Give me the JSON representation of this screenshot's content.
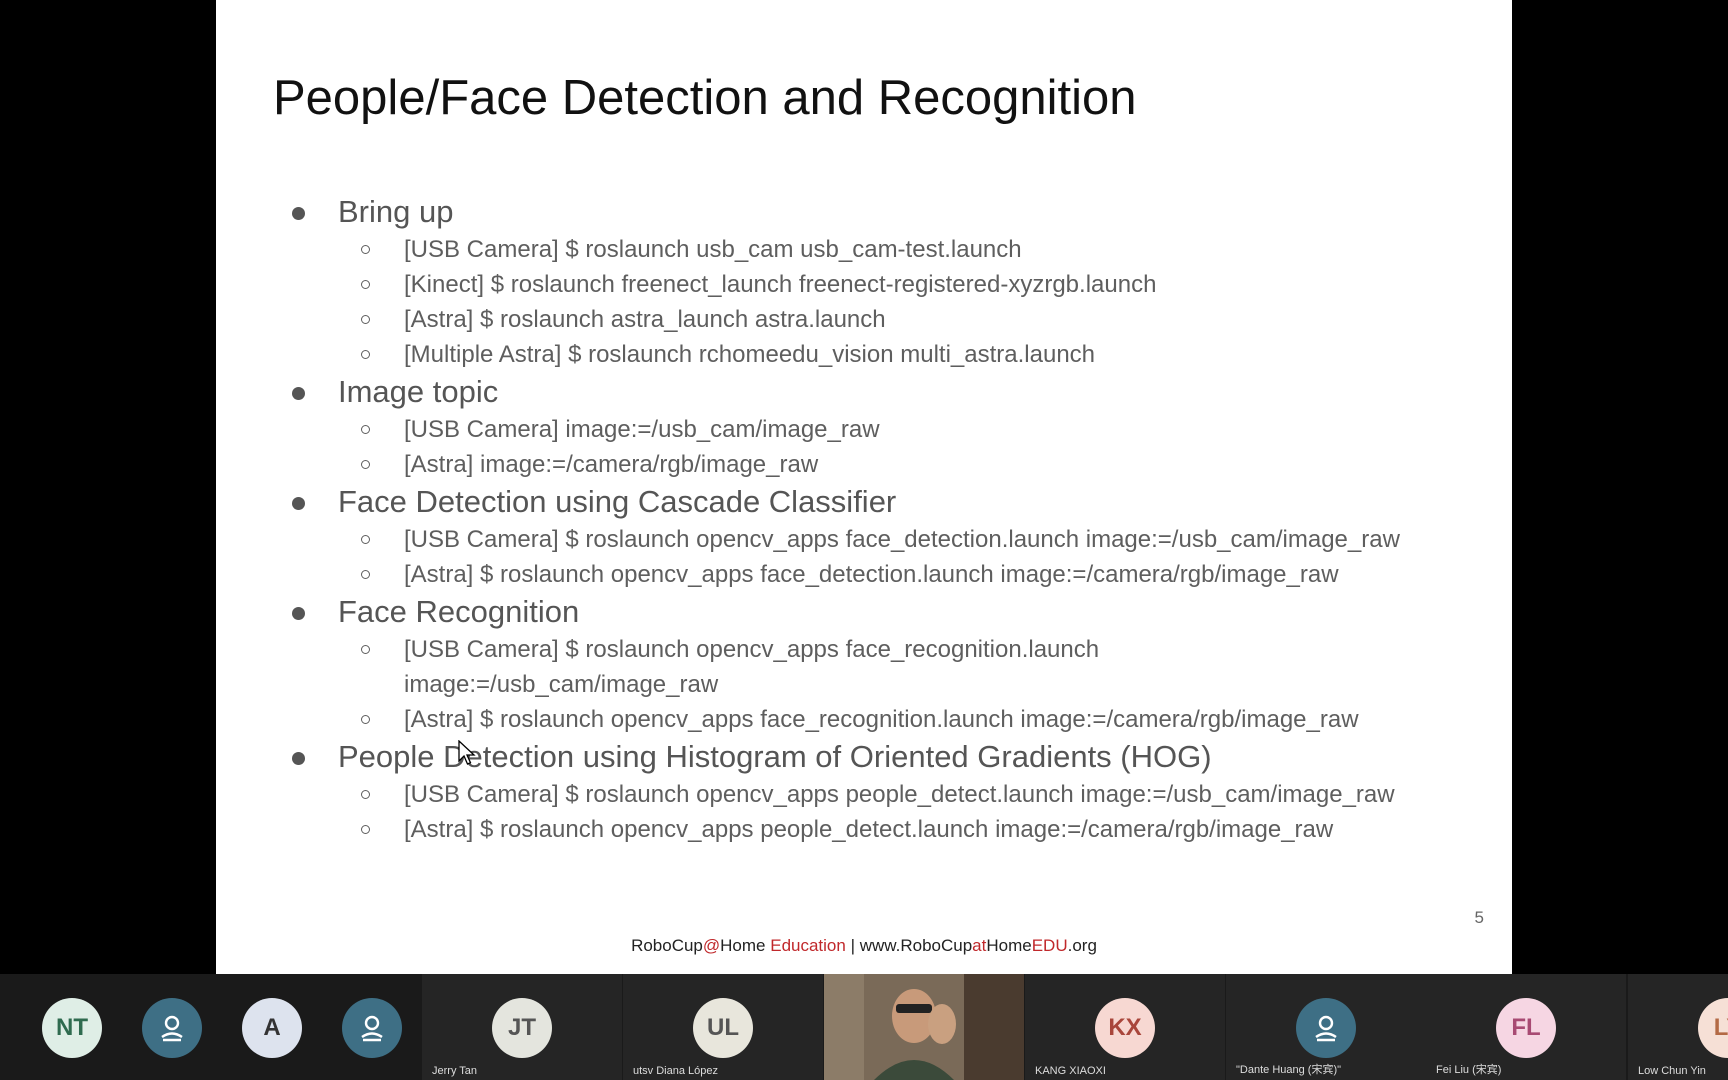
{
  "slide": {
    "title": "People/Face Detection and Recognition",
    "sections": [
      {
        "heading": "Bring up",
        "items": [
          "[USB Camera] $ roslaunch usb_cam usb_cam-test.launch",
          "[Kinect] $ roslaunch freenect_launch freenect-registered-xyzrgb.launch",
          "[Astra] $ roslaunch astra_launch astra.launch",
          "[Multiple Astra] $ roslaunch rchomeedu_vision multi_astra.launch"
        ]
      },
      {
        "heading": "Image topic",
        "items": [
          "[USB Camera] image:=/usb_cam/image_raw",
          "[Astra] image:=/camera/rgb/image_raw"
        ]
      },
      {
        "heading": "Face Detection using Cascade Classifier",
        "items": [
          "[USB Camera] $ roslaunch opencv_apps face_detection.launch image:=/usb_cam/image_raw",
          "[Astra] $ roslaunch opencv_apps face_detection.launch image:=/camera/rgb/image_raw"
        ]
      },
      {
        "heading": "Face Recognition",
        "items": [
          "[USB Camera] $ roslaunch opencv_apps face_recognition.launch image:=/usb_cam/image_raw",
          "[Astra] $ roslaunch opencv_apps face_recognition.launch image:=/camera/rgb/image_raw"
        ]
      },
      {
        "heading": "People Detection using Histogram of Oriented Gradients (HOG)",
        "items": [
          "[USB Camera] $ roslaunch opencv_apps people_detect.launch image:=/usb_cam/image_raw",
          "[Astra] $ roslaunch opencv_apps people_detect.launch image:=/camera/rgb/image_raw"
        ]
      }
    ],
    "page_number": "5",
    "footer": {
      "part1": "RoboCup",
      "at": "@",
      "part2": "Home ",
      "edu": "Education",
      "sep": " | www.RoboCup",
      "at2": "at",
      "home": "Home",
      "edu2": "EDU",
      "org": ".org"
    }
  },
  "participants": [
    {
      "initials": "NT",
      "name": "",
      "avatar_color": "#dfeee6",
      "text_color": "#2f6b4f",
      "type": "initials"
    },
    {
      "initials": "",
      "name": "",
      "avatar_color": "#3e6f85",
      "type": "person-icon"
    },
    {
      "initials": "A",
      "name": "",
      "avatar_color": "#dde3ee",
      "text_color": "#333",
      "type": "initials"
    },
    {
      "initials": "",
      "name": "",
      "avatar_color": "#3e6f85",
      "type": "person-icon"
    },
    {
      "initials": "JT",
      "name": "Jerry Tan",
      "avatar_color": "#e4e5de",
      "text_color": "#555",
      "type": "initials"
    },
    {
      "initials": "UL",
      "name": "utsv Diana López",
      "avatar_color": "#e8e6dc",
      "text_color": "#555",
      "type": "initials"
    },
    {
      "initials": "",
      "name": "",
      "type": "video"
    },
    {
      "initials": "KX",
      "name": "KANG XIAOXI",
      "avatar_color": "#f7d8d2",
      "text_color": "#a9463b",
      "type": "initials"
    },
    {
      "initials": "",
      "name": "\"Dante Huang (宋宾)\"",
      "avatar_color": "#3e6f85",
      "type": "person-icon"
    },
    {
      "initials": "FL",
      "name": "Fei Liu (宋宾)",
      "avatar_color": "#f6d6e3",
      "text_color": "#a84a73",
      "type": "initials"
    },
    {
      "initials": "LY",
      "name": "Low Chun Yin",
      "avatar_color": "#f6e0d6",
      "text_color": "#b36a45",
      "type": "initials"
    }
  ]
}
